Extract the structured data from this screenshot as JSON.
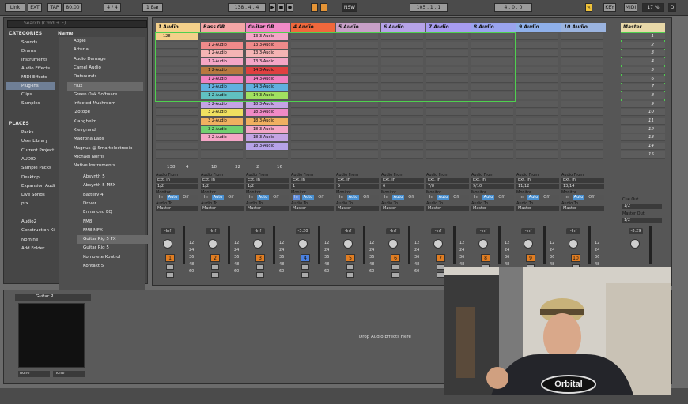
{
  "transport": {
    "link": "Link",
    "ext": "EXT",
    "tap": "TAP",
    "tempo": "80.00",
    "signature": "4 / 4",
    "quant": "1 Bar",
    "position": "138 . 4 . 4",
    "loop_start": "105 . 1 . 1",
    "loop_length": "4 . 0 . 0",
    "key": "KEY",
    "midi": "MIDI",
    "cpu": "17 %",
    "d": "D",
    "nsw": "NSW"
  },
  "browser": {
    "search_placeholder": "Search (Cmd + F)",
    "categories_title": "CATEGORIES",
    "name_header": "Name",
    "categories": [
      "Sounds",
      "Drums",
      "Instruments",
      "Audio Effects",
      "MIDI Effects",
      "Plug-ins",
      "Clips",
      "Samples"
    ],
    "places_title": "PLACES",
    "places": [
      "Packs",
      "User Library",
      "Current Project",
      "AUDIO",
      "Sample Packs",
      "Desktop",
      "Expansion Audi",
      "Live Songs",
      "ptx",
      "",
      "Audio2",
      "Construction Ki",
      "Nomine",
      "Add Folder..."
    ],
    "items": [
      "Apple",
      "Arturia",
      "Audio Damage",
      "Camel Audio",
      "Datsounds",
      "Flux",
      "Green Oak Software",
      "Infected Mushroom",
      "iZotope",
      "Klanghelm",
      "Klevgrand",
      "Madrona Labs",
      "Magnus @ Smartelectronix",
      "Michael Norris",
      "Native Instruments"
    ],
    "subitems": [
      "Absynth 5",
      "Absynth 5 MFX",
      "Battery 4",
      "Driver",
      "Enhanced EQ",
      "FM8",
      "FM8 MFX",
      "Guitar Rig 5 FX",
      "Guitar Rig 5",
      "Komplete Kontrol",
      "Kontakt 5"
    ]
  },
  "tracks": [
    {
      "name": "1 Audio",
      "color": "#f4d08a"
    },
    {
      "name": "Bass GR",
      "color": "#f4a6a6"
    },
    {
      "name": "Guitar GR",
      "color": "#f08ac6"
    },
    {
      "name": "4 Audio",
      "color": "#f0683c"
    },
    {
      "name": "5 Audio",
      "color": "#c8a0c8"
    },
    {
      "name": "6 Audio",
      "color": "#b6a3e8"
    },
    {
      "name": "7 Audio",
      "color": "#a79cf0"
    },
    {
      "name": "8 Audio",
      "color": "#9aa4ee"
    },
    {
      "name": "9 Audio",
      "color": "#8fb0ea"
    },
    {
      "name": "10 Audio",
      "color": "#9bb4e0"
    }
  ],
  "master": {
    "name": "Master",
    "cue_out_label": "Cue Out",
    "cue_out": "1/2",
    "master_out_label": "Master Out",
    "master_out": "1/2",
    "volume": "-8.29"
  },
  "scenes": [
    "1",
    "2",
    "3",
    "4",
    "5",
    "6",
    "7",
    "8",
    "9",
    "10",
    "11",
    "12",
    "13",
    "14",
    "15"
  ],
  "clips": {
    "col0": [
      {
        "row": 0,
        "label": "128",
        "color": "#f4d08a",
        "playing": true
      }
    ],
    "col1": [
      {
        "row": 1,
        "label": "1 2-Audio",
        "color": "#f08a8a"
      },
      {
        "row": 2,
        "label": "1 2-Audio",
        "color": "#f4b4b4"
      },
      {
        "row": 3,
        "label": "1 2-Audio",
        "color": "#f4a6c6"
      },
      {
        "row": 4,
        "label": "1 2-Audio",
        "color": "#b87840"
      },
      {
        "row": 5,
        "label": "1 2-Audio",
        "color": "#f080c0"
      },
      {
        "row": 6,
        "label": "1 2-Audio",
        "color": "#60b0e0"
      },
      {
        "row": 7,
        "label": "1 2-Audio",
        "color": "#60c0c0"
      },
      {
        "row": 8,
        "label": "3 2-Audio",
        "color": "#c4a4e4"
      },
      {
        "row": 9,
        "label": "3 2-Audio",
        "color": "#f0e060",
        "playing": true
      },
      {
        "row": 10,
        "label": "3 2-Audio",
        "color": "#f0b060"
      },
      {
        "row": 11,
        "label": "3 2-Audio",
        "color": "#70d070"
      },
      {
        "row": 12,
        "label": "3 2-Audio",
        "color": "#f4a6c6"
      }
    ],
    "col2": [
      {
        "row": 0,
        "label": "13 3-Audio",
        "color": "#f4a6c6"
      },
      {
        "row": 1,
        "label": "13 3-Audio",
        "color": "#f08a8a"
      },
      {
        "row": 2,
        "label": "13 3-Audio",
        "color": "#f4b4b4"
      },
      {
        "row": 3,
        "label": "13 3-Audio",
        "color": "#f4a6c6"
      },
      {
        "row": 4,
        "label": "14 3-Audio",
        "color": "#e04040"
      },
      {
        "row": 5,
        "label": "14 3-Audio",
        "color": "#f080c0"
      },
      {
        "row": 6,
        "label": "14 3-Audio",
        "color": "#60b0e0"
      },
      {
        "row": 7,
        "label": "14 3-Audio",
        "color": "#a0e060"
      },
      {
        "row": 8,
        "label": "18 3-Audio",
        "color": "#c4a4e4"
      },
      {
        "row": 9,
        "label": "18 3-Audio",
        "color": "#f08ac6"
      },
      {
        "row": 10,
        "label": "18 3-Audio",
        "color": "#f0b060"
      },
      {
        "row": 11,
        "label": "18 3-Audio",
        "color": "#f4a6c6"
      },
      {
        "row": 12,
        "label": "18 3-Audio",
        "color": "#c4a4e4"
      },
      {
        "row": 13,
        "label": "18 3-Audio",
        "color": "#b6a3e8"
      }
    ]
  },
  "io": {
    "audio_from": "Audio From",
    "monitor": "Monitor",
    "audio_to": "Audio To",
    "in": "In",
    "auto": "Auto",
    "off": "Off",
    "master": "Master",
    "ext_in": "Ext. In",
    "inputs": [
      "1/2",
      "1/2",
      "1/2",
      "1",
      "5",
      "6",
      "7/8",
      "9/10",
      "11/12",
      "13/14"
    ]
  },
  "mixer": {
    "volumes": [
      "-Inf",
      "-Inf",
      "-Inf",
      "-3.20",
      "-Inf",
      "-Inf",
      "-Inf",
      "-Inf",
      "-Inf",
      "-Inf"
    ],
    "ticks": [
      "12",
      "24",
      "36",
      "48",
      "60"
    ],
    "numbers": [
      "1",
      "2",
      "3",
      "4",
      "5",
      "6",
      "7",
      "8",
      "9",
      "10"
    ],
    "strip_counts": [
      "138",
      "4",
      "18",
      "32",
      "2",
      "16"
    ]
  },
  "device": {
    "title": "Guitar R...",
    "drop_text": "Drop Audio Effects Here",
    "sel1": "none",
    "sel2": "none"
  },
  "video_shirt_text": "Orbital"
}
